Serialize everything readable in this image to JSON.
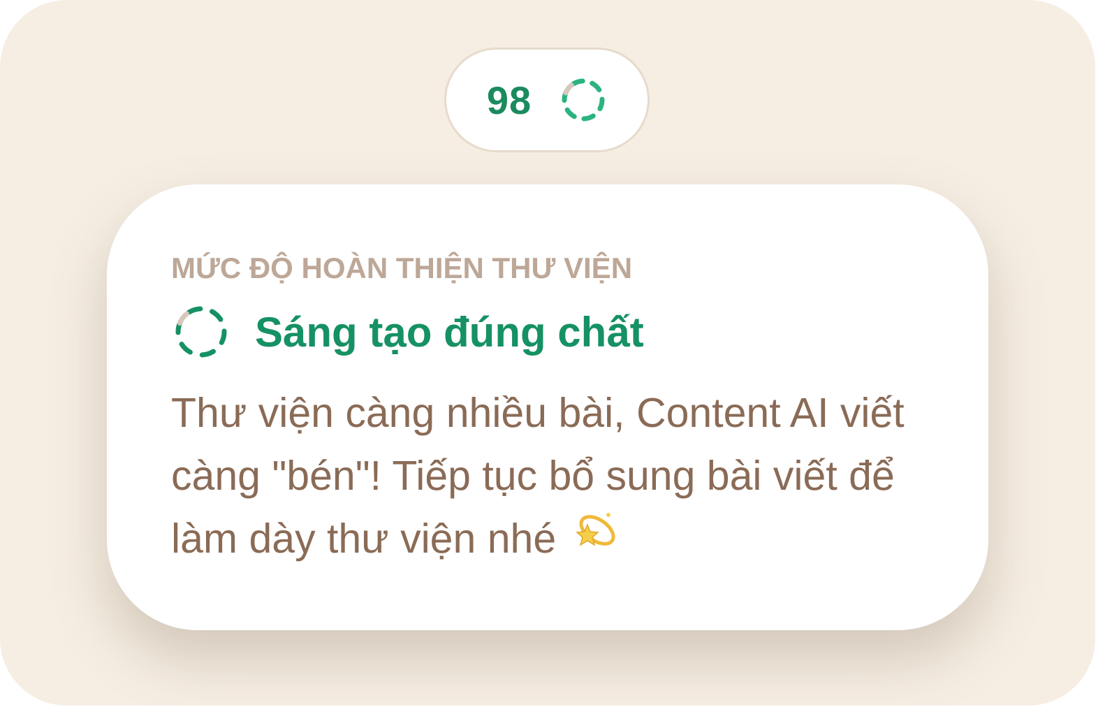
{
  "score": {
    "value": "98",
    "icon": "dashed-progress-ring-icon"
  },
  "card": {
    "label": "MỨC ĐỘ HOÀN THIỆN THƯ VIỆN",
    "title_icon": "dashed-progress-ring-icon",
    "title": "Sáng tạo đúng chất",
    "message": "Thư viện càng nhiều bài, Content AI viết càng \"bén\"! Tiếp tục bổ sung bài viết để làm dày thư viện nhé",
    "message_emoji": "dizzy-star-emoji"
  },
  "colors": {
    "accent_green": "#169163",
    "ring_inactive": "#d6c8bb",
    "background": "#f6eee3",
    "label": "#bda797",
    "body_text": "#8a6b56"
  }
}
